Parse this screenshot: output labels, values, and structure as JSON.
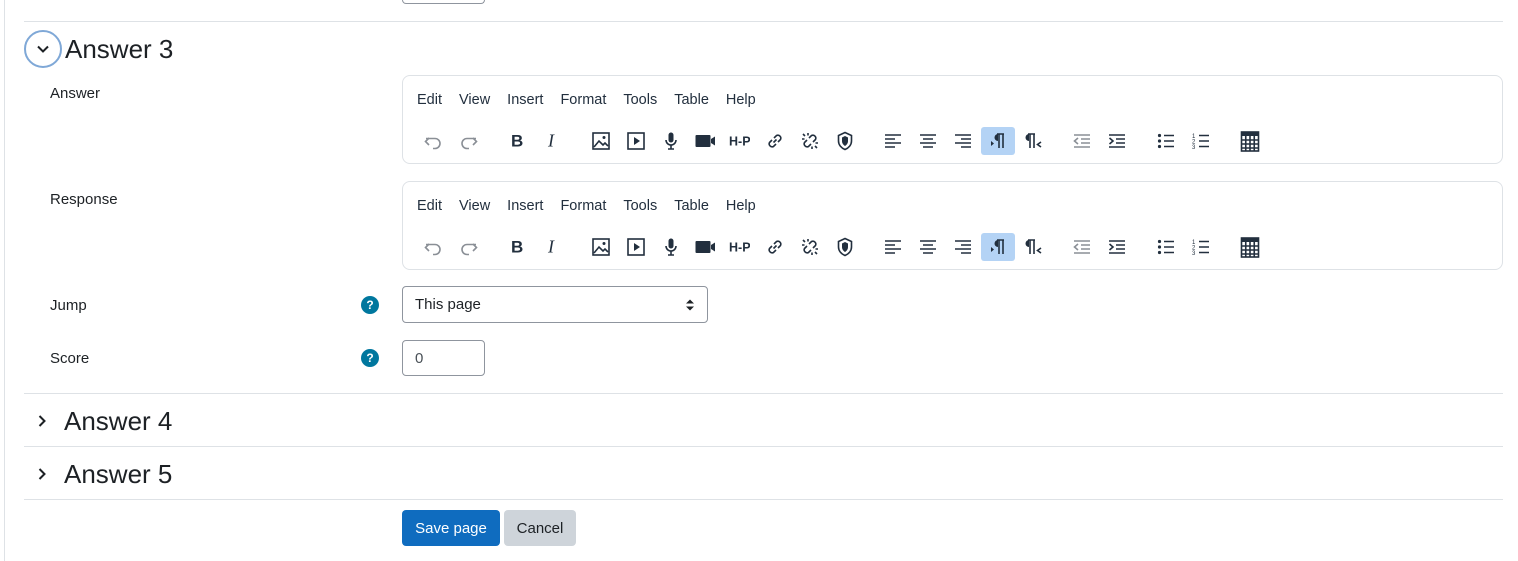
{
  "answer3": {
    "title": "Answer 3",
    "answer_label": "Answer",
    "response_label": "Response",
    "jump_label": "Jump",
    "jump_value": "This page",
    "score_label": "Score",
    "score_value": "0"
  },
  "editor_menu": [
    "Edit",
    "View",
    "Insert",
    "Format",
    "Tools",
    "Table",
    "Help"
  ],
  "toolbar_icons": [
    "undo-icon",
    "redo-icon",
    "bold-icon",
    "italic-icon",
    "image-icon",
    "media-icon",
    "record-audio-icon",
    "record-video-icon",
    "h5p-icon",
    "link-icon",
    "unlink-icon",
    "shield-icon",
    "align-left-icon",
    "align-center-icon",
    "align-right-icon",
    "ltr-icon",
    "rtl-icon",
    "outdent-icon",
    "indent-icon",
    "bullet-list-icon",
    "numbered-list-icon",
    "table-icon"
  ],
  "answer4": {
    "title": "Answer 4"
  },
  "answer5": {
    "title": "Answer 5"
  },
  "help_glyph": "?",
  "buttons": {
    "save": "Save page",
    "cancel": "Cancel"
  },
  "colors": {
    "primary": "#0f6cbf",
    "secondary": "#ced4da",
    "active_tool": "#b4d3f5",
    "help": "#00779e"
  }
}
